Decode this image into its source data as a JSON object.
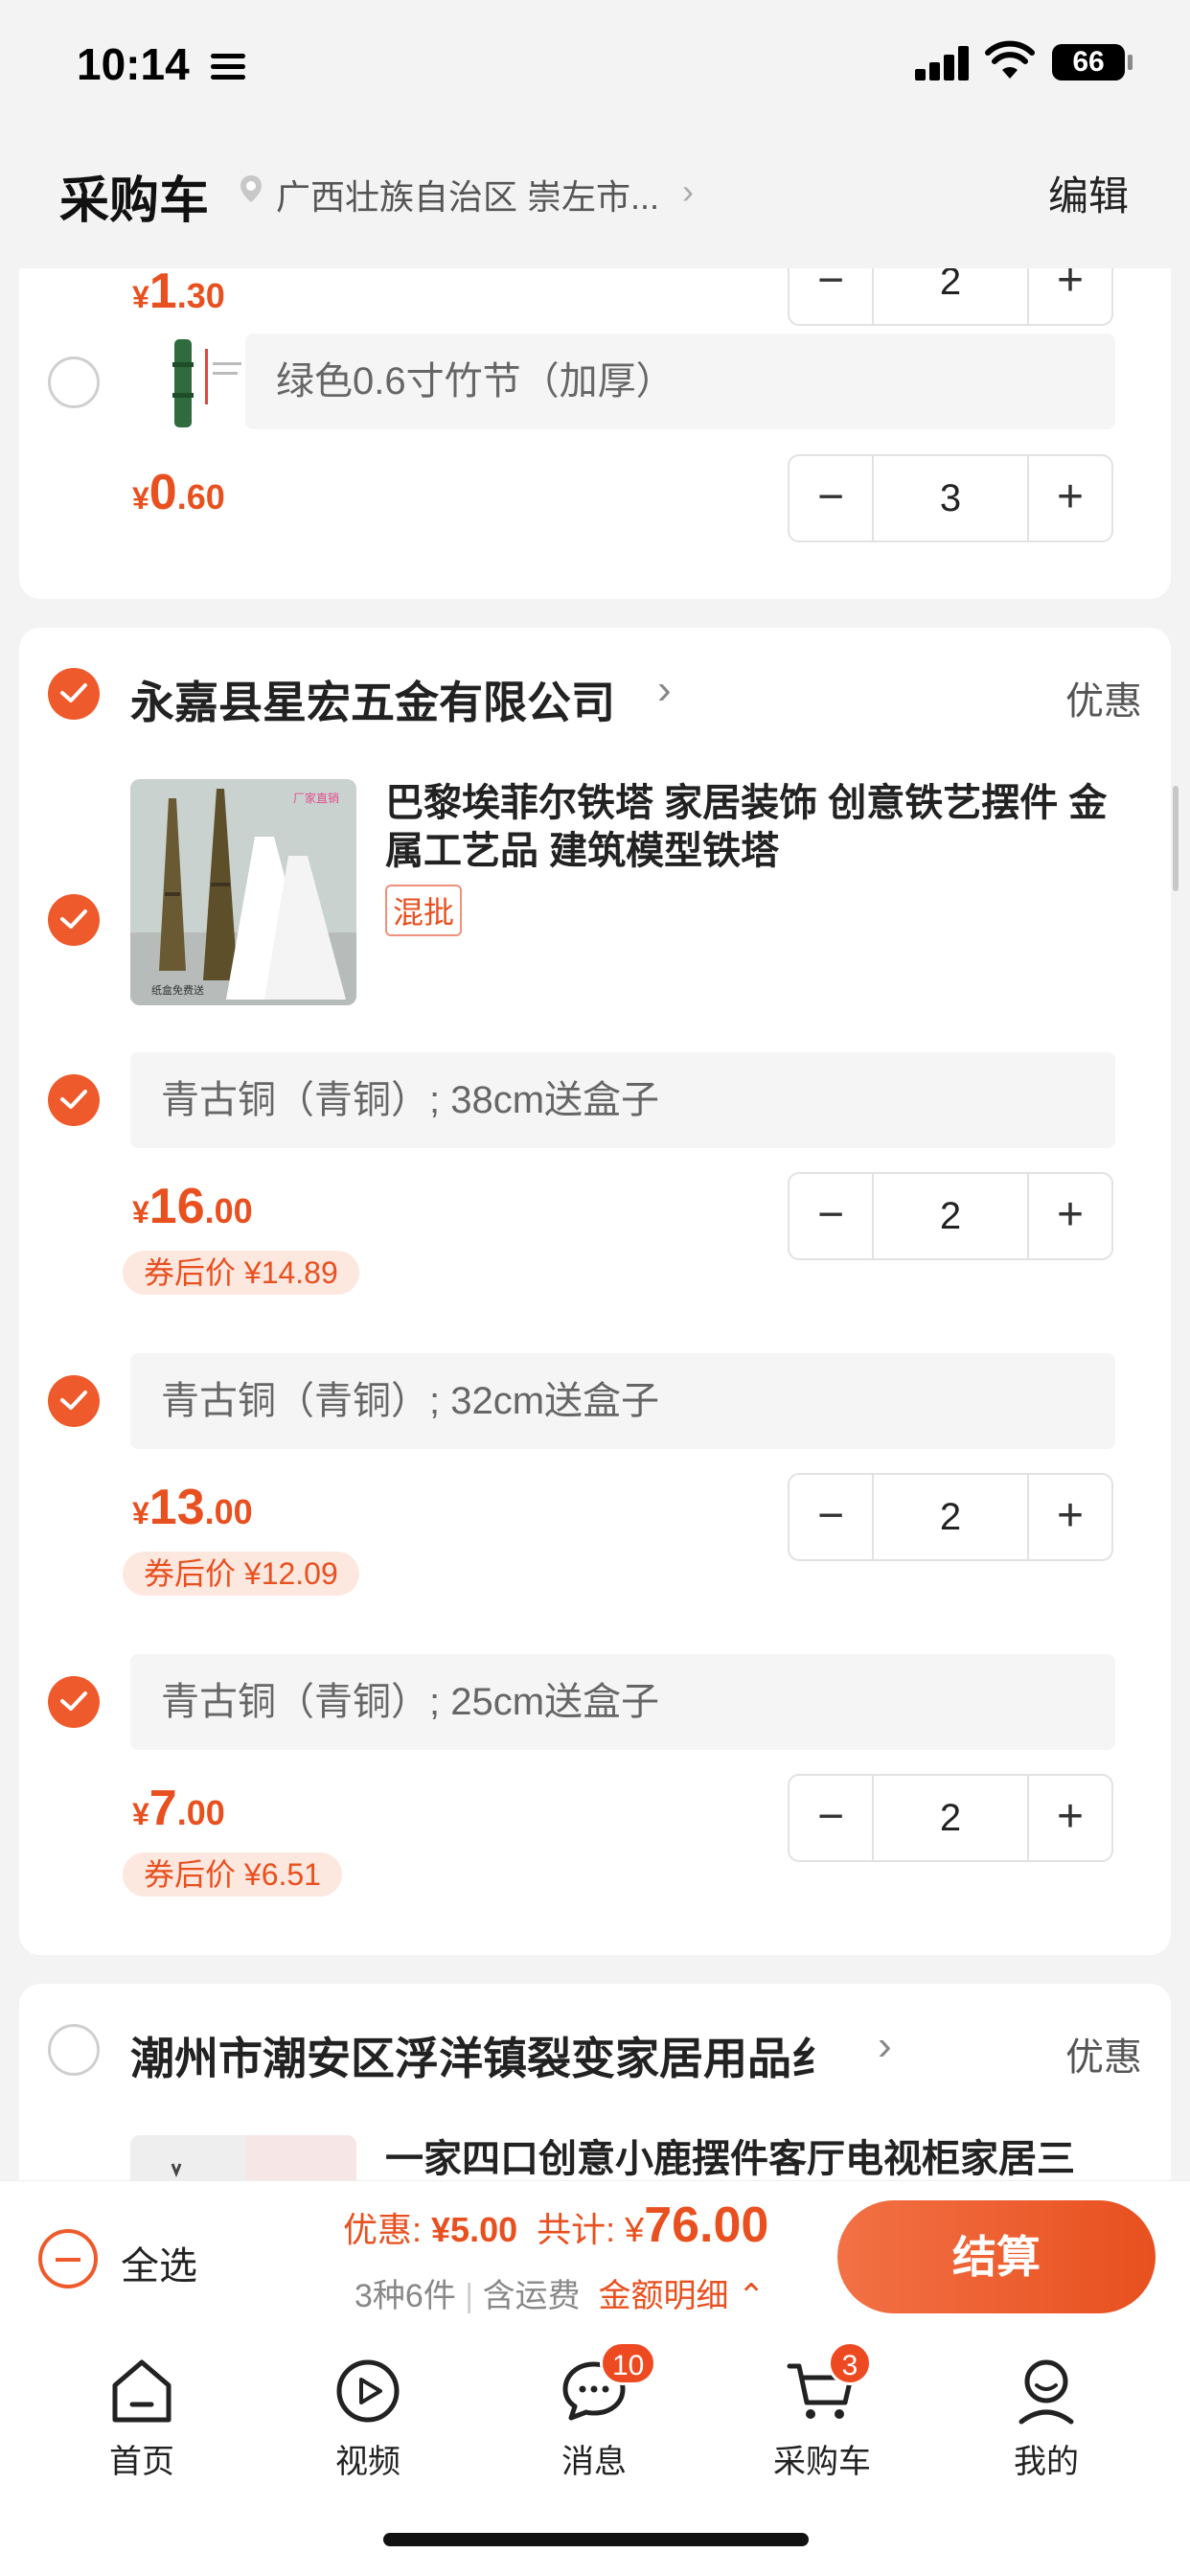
{
  "status_bar": {
    "time": "10:14",
    "battery": "66"
  },
  "header": {
    "title": "采购车",
    "location": "广西壮族自治区 崇左市...",
    "edit": "编辑"
  },
  "card1": {
    "prev_price": {
      "symbol": "¥",
      "int": "1",
      "dec": ".30"
    },
    "prev_qty": "2",
    "spec": "绿色0.6寸竹节（加厚）",
    "price": {
      "symbol": "¥",
      "int": "0",
      "dec": ".60"
    },
    "qty": "3"
  },
  "shop2": {
    "name": "永嘉县星宏五金有限公司",
    "promo": "优惠",
    "product_title": "巴黎埃菲尔铁塔 家居装饰 创意铁艺摆件 金属工艺品 建筑模型铁塔",
    "tag": "混批",
    "img_label_top": "厂家直销",
    "img_label_bottom": "纸盒免费送",
    "variants": [
      {
        "spec": "青古铜（青铜）; 38cm送盒子",
        "price": {
          "symbol": "¥",
          "int": "16",
          "dec": ".00"
        },
        "coupon": "券后价 ¥14.89",
        "qty": "2"
      },
      {
        "spec": "青古铜（青铜）; 32cm送盒子",
        "price": {
          "symbol": "¥",
          "int": "13",
          "dec": ".00"
        },
        "coupon": "券后价 ¥12.09",
        "qty": "2"
      },
      {
        "spec": "青古铜（青铜）; 25cm送盒子",
        "price": {
          "symbol": "¥",
          "int": "7",
          "dec": ".00"
        },
        "coupon": "券后价 ¥6.51",
        "qty": "2"
      }
    ]
  },
  "shop3": {
    "name": "潮州市潮安区浮洋镇裂变家居用品纟",
    "promo": "优惠",
    "product_title": "一家四口创意小鹿摆件客厅电视柜家居三"
  },
  "bottom": {
    "select_all": "全选",
    "discount_label": "优惠:",
    "discount": "¥5.00",
    "total_label": "共计:",
    "total_symbol": "¥",
    "total": "76.00",
    "count": "3种6件",
    "shipping": "含运费",
    "detail": "金额明细",
    "checkout": "结算"
  },
  "tabs": [
    {
      "label": "首页",
      "icon": "home-icon"
    },
    {
      "label": "视频",
      "icon": "video-icon"
    },
    {
      "label": "消息",
      "icon": "message-icon",
      "badge": "10"
    },
    {
      "label": "采购车",
      "icon": "cart-icon",
      "badge": "3"
    },
    {
      "label": "我的",
      "icon": "profile-icon"
    }
  ],
  "colors": {
    "accent": "#ee5a2c",
    "price": "#e8501f"
  }
}
